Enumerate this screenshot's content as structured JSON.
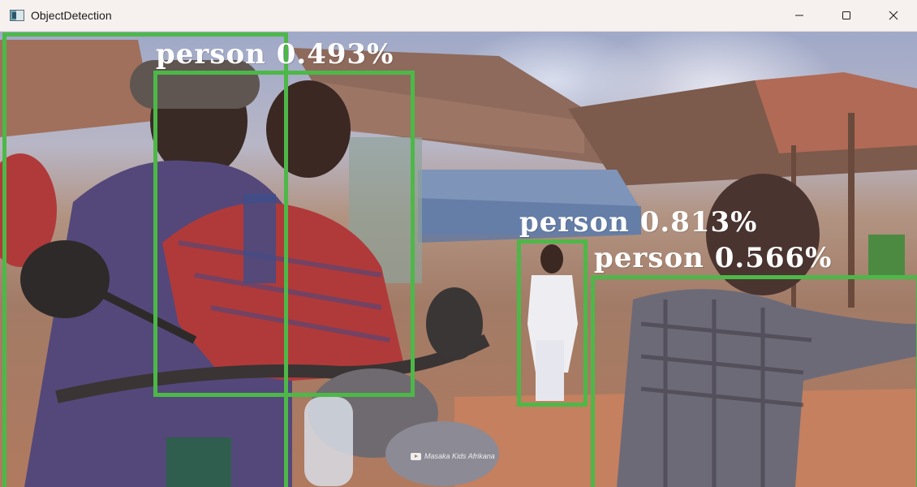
{
  "window": {
    "title": "ObjectDetection",
    "icon": "app-window-icon",
    "controls": [
      "minimize-icon",
      "maximize-icon",
      "close-icon"
    ]
  },
  "detections": [
    {
      "label": "person 0.493%"
    },
    {
      "label": "person 0.813%"
    },
    {
      "label": "person 0.566%"
    }
  ],
  "watermark": {
    "text": "Masaka Kids Afrikana",
    "icon": "video-play-icon"
  },
  "colors": {
    "box": "#4db848",
    "label_text": "#ffffff",
    "titlebar_bg": "#f6f1ee"
  }
}
